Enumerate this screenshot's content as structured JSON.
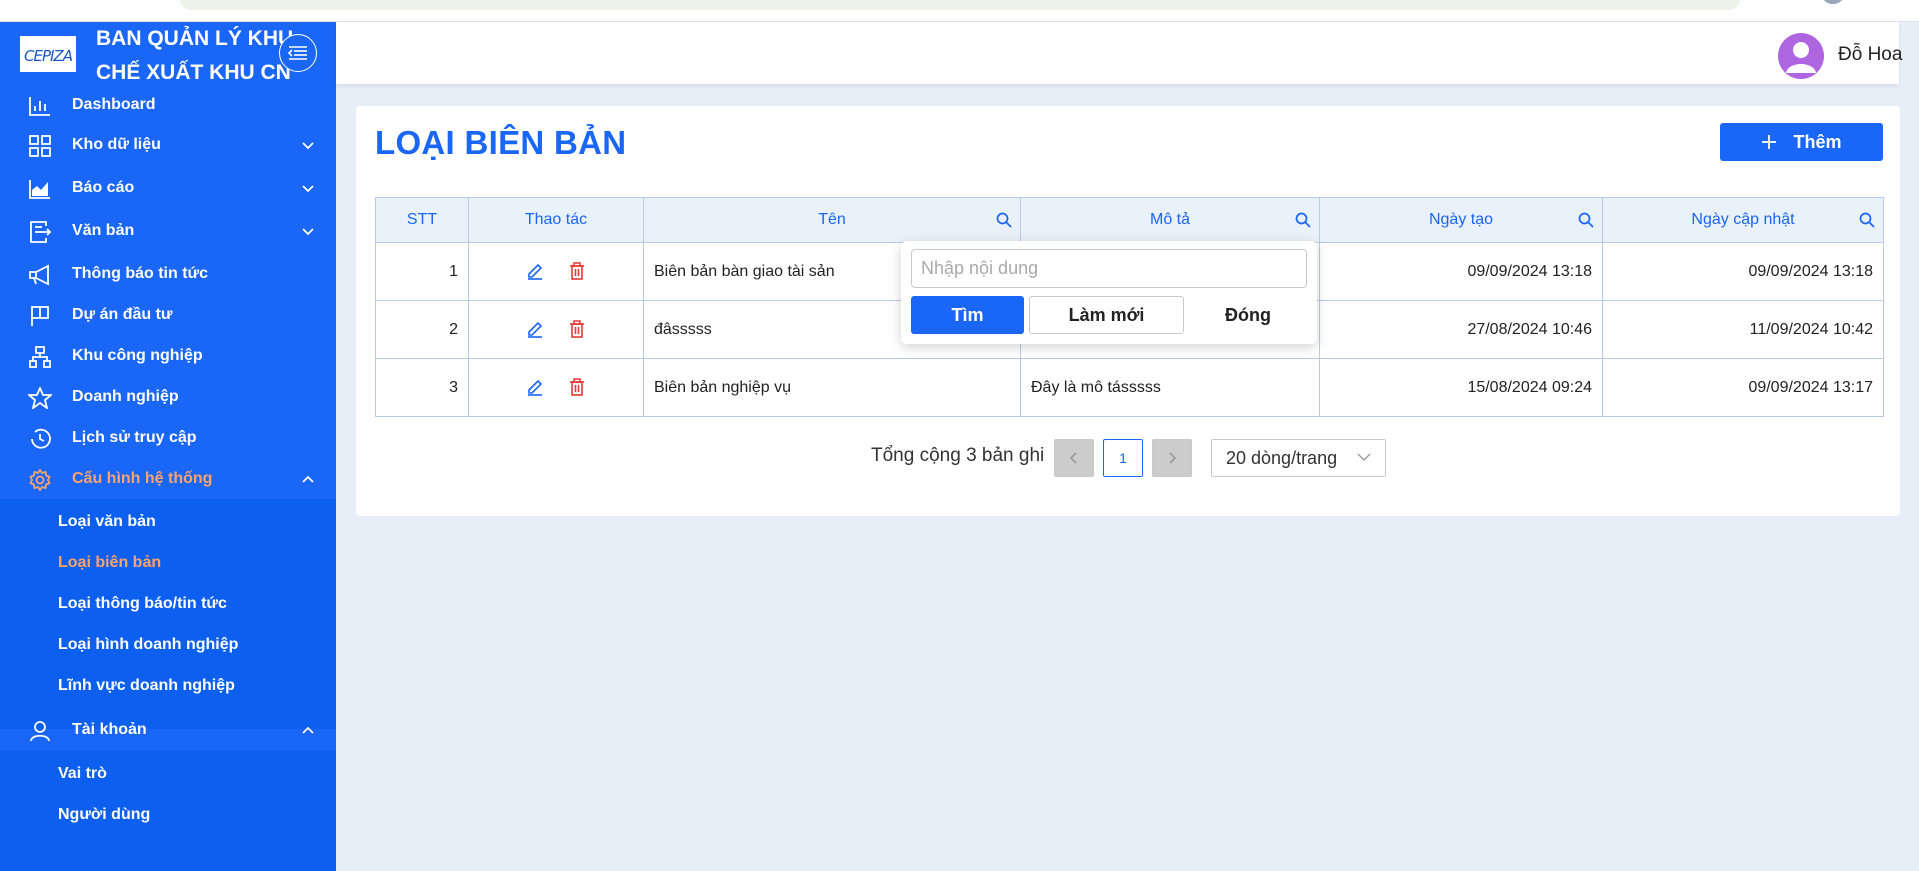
{
  "sidebar": {
    "logo_text": "CEPIZA",
    "org_line1": "BAN QUẢN LÝ KHU",
    "org_line2": "CHẾ XUẤT KHU CN",
    "items": [
      {
        "label": "Dashboard",
        "icon": "bar-chart-icon"
      },
      {
        "label": "Kho dữ liệu",
        "icon": "grid-icon"
      },
      {
        "label": "Báo cáo",
        "icon": "area-chart-icon"
      },
      {
        "label": "Văn bản",
        "icon": "document-icon"
      },
      {
        "label": "Thông báo tin tức",
        "icon": "megaphone-icon"
      },
      {
        "label": "Dự án đầu tư",
        "icon": "flag-icon"
      },
      {
        "label": "Khu công nghiệp",
        "icon": "cluster-icon"
      },
      {
        "label": "Doanh nghiệp",
        "icon": "star-icon"
      },
      {
        "label": "Lịch sử truy cập",
        "icon": "history-icon"
      },
      {
        "label": "Cấu hình hệ thống",
        "icon": "gear-icon"
      }
    ],
    "config_sub": [
      "Loại văn bản",
      "Loại biên bản",
      "Loại thông báo/tin tức",
      "Loại hình doanh nghiệp",
      "Lĩnh vực doanh nghiệp"
    ],
    "account": {
      "label": "Tài khoản",
      "icon": "user-icon"
    },
    "account_sub": [
      "Vai trò",
      "Người dùng"
    ],
    "active_color": "#ffa36c",
    "bg_color": "#1a66f6"
  },
  "header": {
    "user_name": "Đỗ Hoa"
  },
  "main": {
    "title": "LOẠI BIÊN BẢN",
    "add_button": "Thêm",
    "columns": [
      "STT",
      "Thao tác",
      "Tên",
      "Mô tả",
      "Ngày tạo",
      "Ngày cập nhật"
    ],
    "rows": [
      {
        "stt": "1",
        "ten": "Biên bản bàn giao tài sản",
        "mo_ta": "",
        "ngay_tao": "09/09/2024 13:18",
        "ngay_cap_nhat": "09/09/2024 13:18"
      },
      {
        "stt": "2",
        "ten": "đâsssss",
        "mo_ta": "",
        "ngay_tao": "27/08/2024 10:46",
        "ngay_cap_nhat": "11/09/2024 10:42"
      },
      {
        "stt": "3",
        "ten": "Biên bản nghiệp vụ",
        "mo_ta": "Đây là mô tásssss",
        "ngay_tao": "15/08/2024 09:24",
        "ngay_cap_nhat": "09/09/2024 13:17"
      }
    ]
  },
  "search_popup": {
    "placeholder": "Nhập nội dung",
    "find": "Tìm",
    "reset": "Làm mới",
    "close": "Đóng"
  },
  "pagination": {
    "total": "Tổng cộng 3 bản ghi",
    "current": "1",
    "page_size": "20 dòng/trang"
  }
}
